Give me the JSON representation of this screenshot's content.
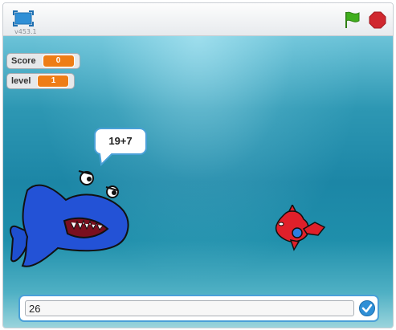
{
  "player": {
    "version": "v453.1"
  },
  "monitors": [
    {
      "label": "Score",
      "value": "0"
    },
    {
      "label": "level",
      "value": "1"
    }
  ],
  "speech_bubble": "19+7",
  "answer": {
    "value": "26"
  },
  "colors": {
    "monitor_value_bg": "#ee7d16",
    "accent_blue": "#4aa0d8",
    "flag_green": "#3fae1c",
    "stop_red": "#d0282f"
  },
  "icons": [
    "fullscreen-icon",
    "green-flag-icon",
    "stop-sign-icon",
    "checkmark-icon"
  ]
}
